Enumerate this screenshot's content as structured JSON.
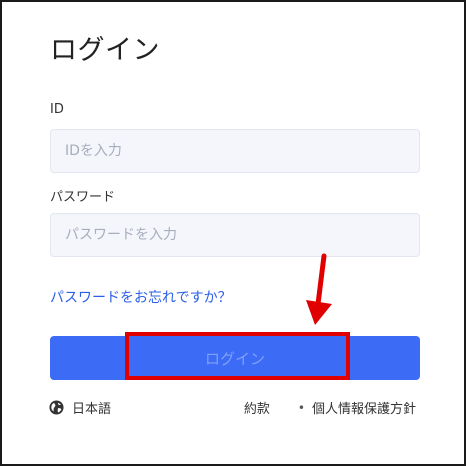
{
  "page": {
    "title": "ログイン"
  },
  "form": {
    "id_label": "ID",
    "id_placeholder": "IDを入力",
    "password_label": "パスワード",
    "password_placeholder": "パスワードを入力",
    "forgot_link": "パスワードをお忘れですか？",
    "login_button": "ログイン"
  },
  "footer": {
    "language": "日本語",
    "language_icon": "globe-icon",
    "terms": "約款",
    "separator": "•",
    "privacy": "個人情報保護方針"
  },
  "colors": {
    "accent": "#3c6cf6",
    "link": "#2b5fe8",
    "annotation": "#e00000"
  }
}
